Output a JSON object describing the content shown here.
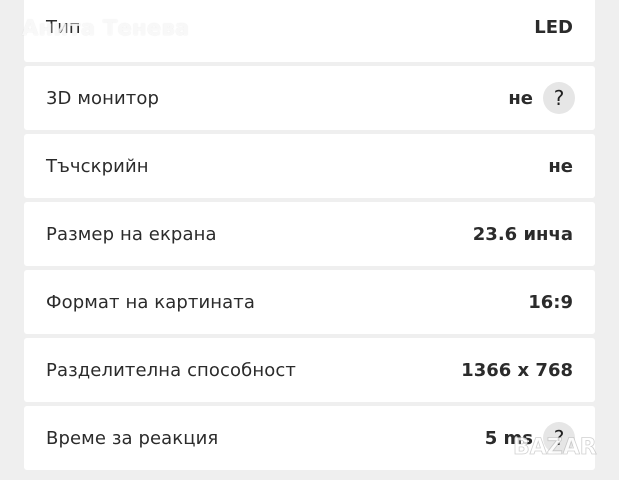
{
  "watermark": {
    "owner_name": "Анита Тенева",
    "logo_text": "BAZAR"
  },
  "specs": [
    {
      "label": "Тип",
      "value": "LED",
      "has_help": false
    },
    {
      "label": "3D монитор",
      "value": "не",
      "has_help": true
    },
    {
      "label": "Тъчскрийн",
      "value": "не",
      "has_help": false
    },
    {
      "label": "Размер на екрана",
      "value": "23.6 инча",
      "has_help": false
    },
    {
      "label": "Формат на картината",
      "value": "16:9",
      "has_help": false
    },
    {
      "label": "Разделителна способност",
      "value": "1366 x 768",
      "has_help": false
    },
    {
      "label": "Време за реакция",
      "value": "5 ms",
      "has_help": true
    }
  ],
  "help_glyph": "?",
  "icons": {
    "help": "question-mark-icon"
  }
}
